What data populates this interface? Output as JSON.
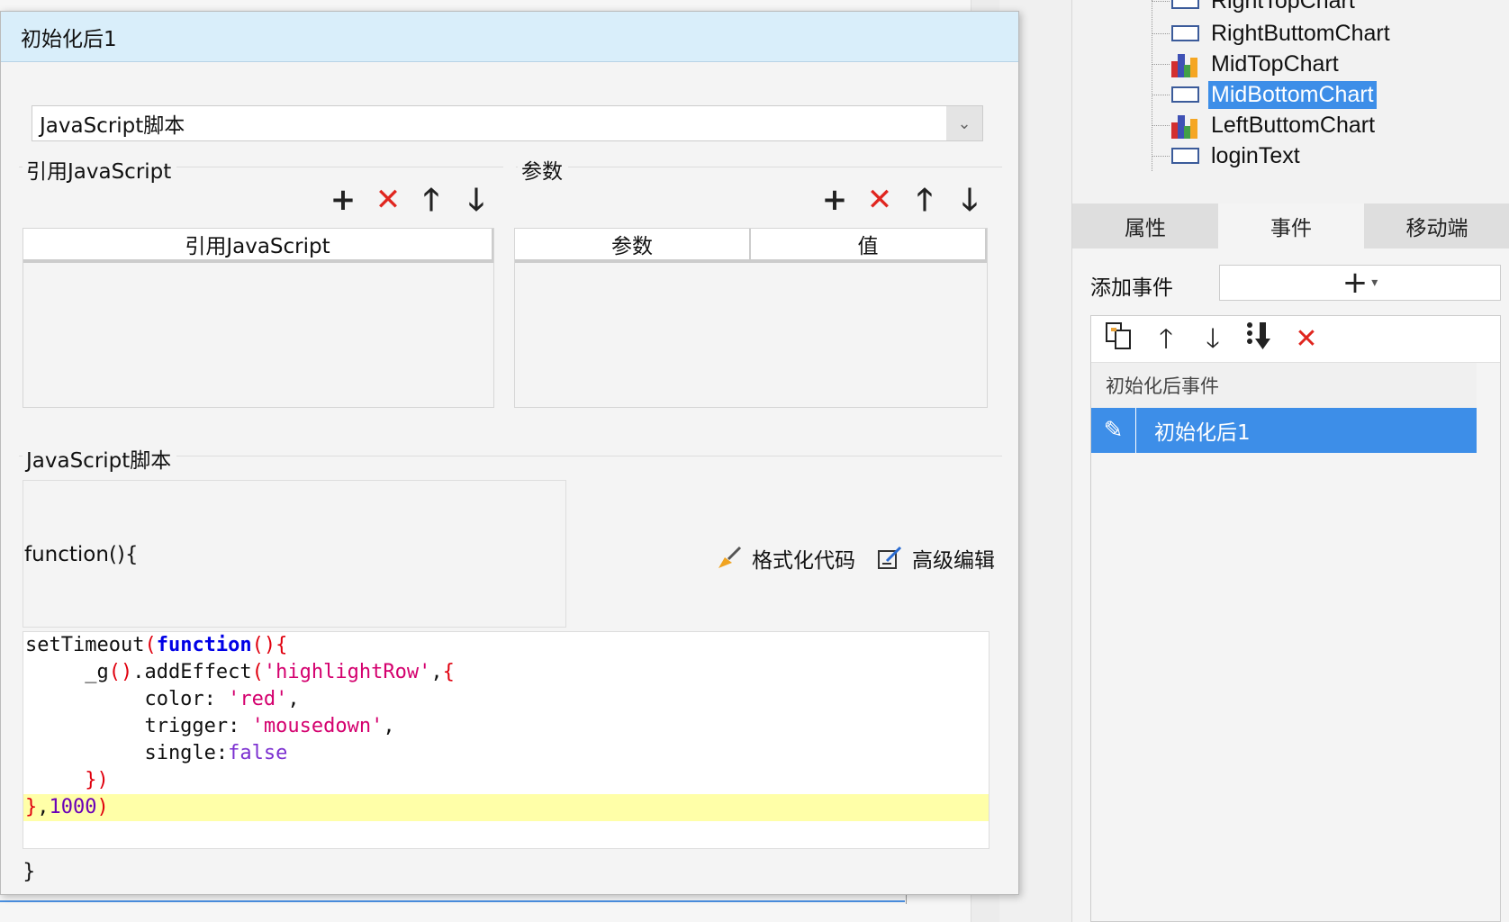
{
  "dialog": {
    "title": "初始化后1",
    "script_type": "JavaScript脚本",
    "ref_js_section": "引用JavaScript",
    "params_section": "参数",
    "ref_js_table": {
      "columns": [
        "引用JavaScript"
      ]
    },
    "params_table": {
      "columns": [
        "参数",
        "值"
      ]
    },
    "js_script_section": "JavaScript脚本",
    "fn_open": "function(){",
    "fn_close": "}",
    "format_code_label": "格式化代码",
    "advanced_edit_label": "高级编辑",
    "code_lines": [
      [
        {
          "t": "setTimeout",
          "c": "plain"
        },
        {
          "t": "(",
          "c": "punc"
        },
        {
          "t": "function",
          "c": "kw"
        },
        {
          "t": "(){",
          "c": "punc"
        }
      ],
      [
        {
          "t": "     _g",
          "c": "plain"
        },
        {
          "t": "()",
          "c": "punc"
        },
        {
          "t": ".addEffect",
          "c": "plain"
        },
        {
          "t": "(",
          "c": "punc"
        },
        {
          "t": "'highlightRow'",
          "c": "str"
        },
        {
          "t": ",",
          "c": "plain"
        },
        {
          "t": "{",
          "c": "punc"
        }
      ],
      [
        {
          "t": "          color: ",
          "c": "plain"
        },
        {
          "t": "'red'",
          "c": "str"
        },
        {
          "t": ",",
          "c": "plain"
        }
      ],
      [
        {
          "t": "          trigger: ",
          "c": "plain"
        },
        {
          "t": "'mousedown'",
          "c": "str"
        },
        {
          "t": ",",
          "c": "plain"
        }
      ],
      [
        {
          "t": "          single:",
          "c": "plain"
        },
        {
          "t": "false",
          "c": "bool"
        }
      ],
      [
        {
          "t": "     })",
          "c": "punc"
        }
      ],
      [
        {
          "t": "}",
          "c": "punc"
        },
        {
          "t": ",",
          "c": "plain"
        },
        {
          "t": "1000",
          "c": "num"
        },
        {
          "t": ")",
          "c": "punc"
        }
      ]
    ],
    "highlighted_line": 6
  },
  "tree": {
    "items": [
      {
        "label": "RightTopChart",
        "icon": "rect-icon",
        "selected": false
      },
      {
        "label": "RightButtomChart",
        "icon": "rect-icon",
        "selected": false
      },
      {
        "label": "MidTopChart",
        "icon": "chart-icon",
        "selected": false
      },
      {
        "label": "MidBottomChart",
        "icon": "rect-icon",
        "selected": true
      },
      {
        "label": "LeftButtomChart",
        "icon": "chart-icon",
        "selected": false
      },
      {
        "label": "loginText",
        "icon": "rect-icon",
        "selected": false
      }
    ]
  },
  "panel_tabs": [
    "属性",
    "事件",
    "移动端"
  ],
  "active_tab": 1,
  "events": {
    "add_event_label": "添加事件",
    "group_label": "初始化后事件",
    "selected_event": "初始化后1"
  },
  "colors": {
    "selection": "#3d8ee8",
    "title_bar": "#d9eefa",
    "delete_red": "#e0261f",
    "highlight_line": "#ffffa8"
  }
}
